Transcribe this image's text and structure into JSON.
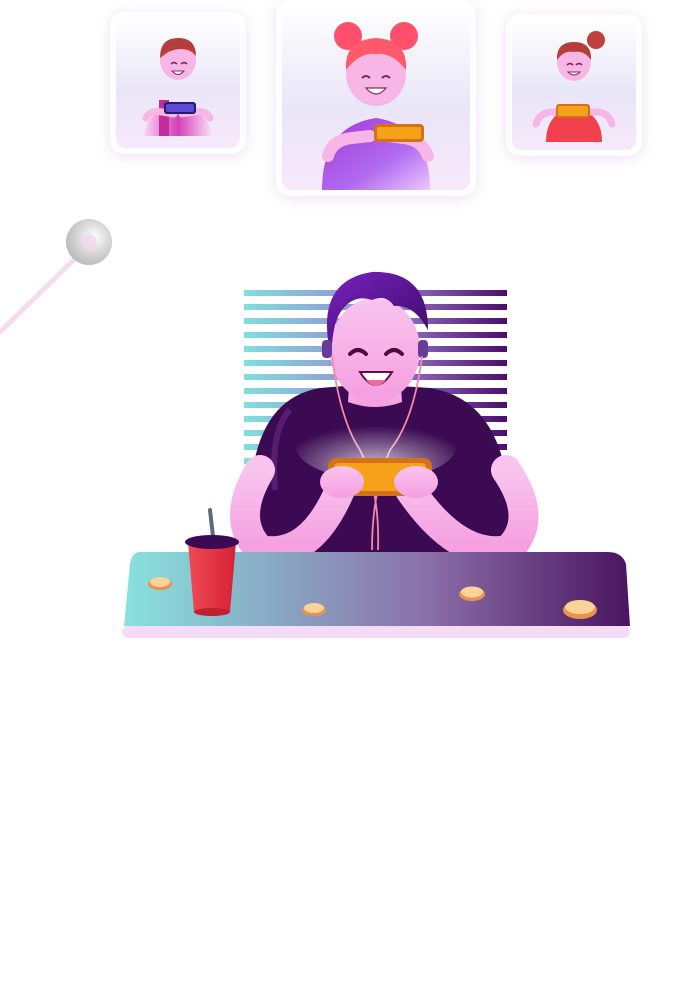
{
  "scene": {
    "description_free": true,
    "palette": {
      "purple_dark": "#3a0a55",
      "purple_mid": "#6b1aa0",
      "violet": "#8e2ed1",
      "pink_skin": "#f8b9ea",
      "pink_light": "#fde4f7",
      "teal": "#7fe0dc",
      "orange_phone": "#f6a11a",
      "red_cup": "#ef3b46",
      "coin": "#f4b860"
    },
    "icons": [
      "friend-card-left",
      "friend-card-center",
      "friend-card-right",
      "pin-dot",
      "gamer",
      "drink-cup",
      "coin"
    ]
  }
}
